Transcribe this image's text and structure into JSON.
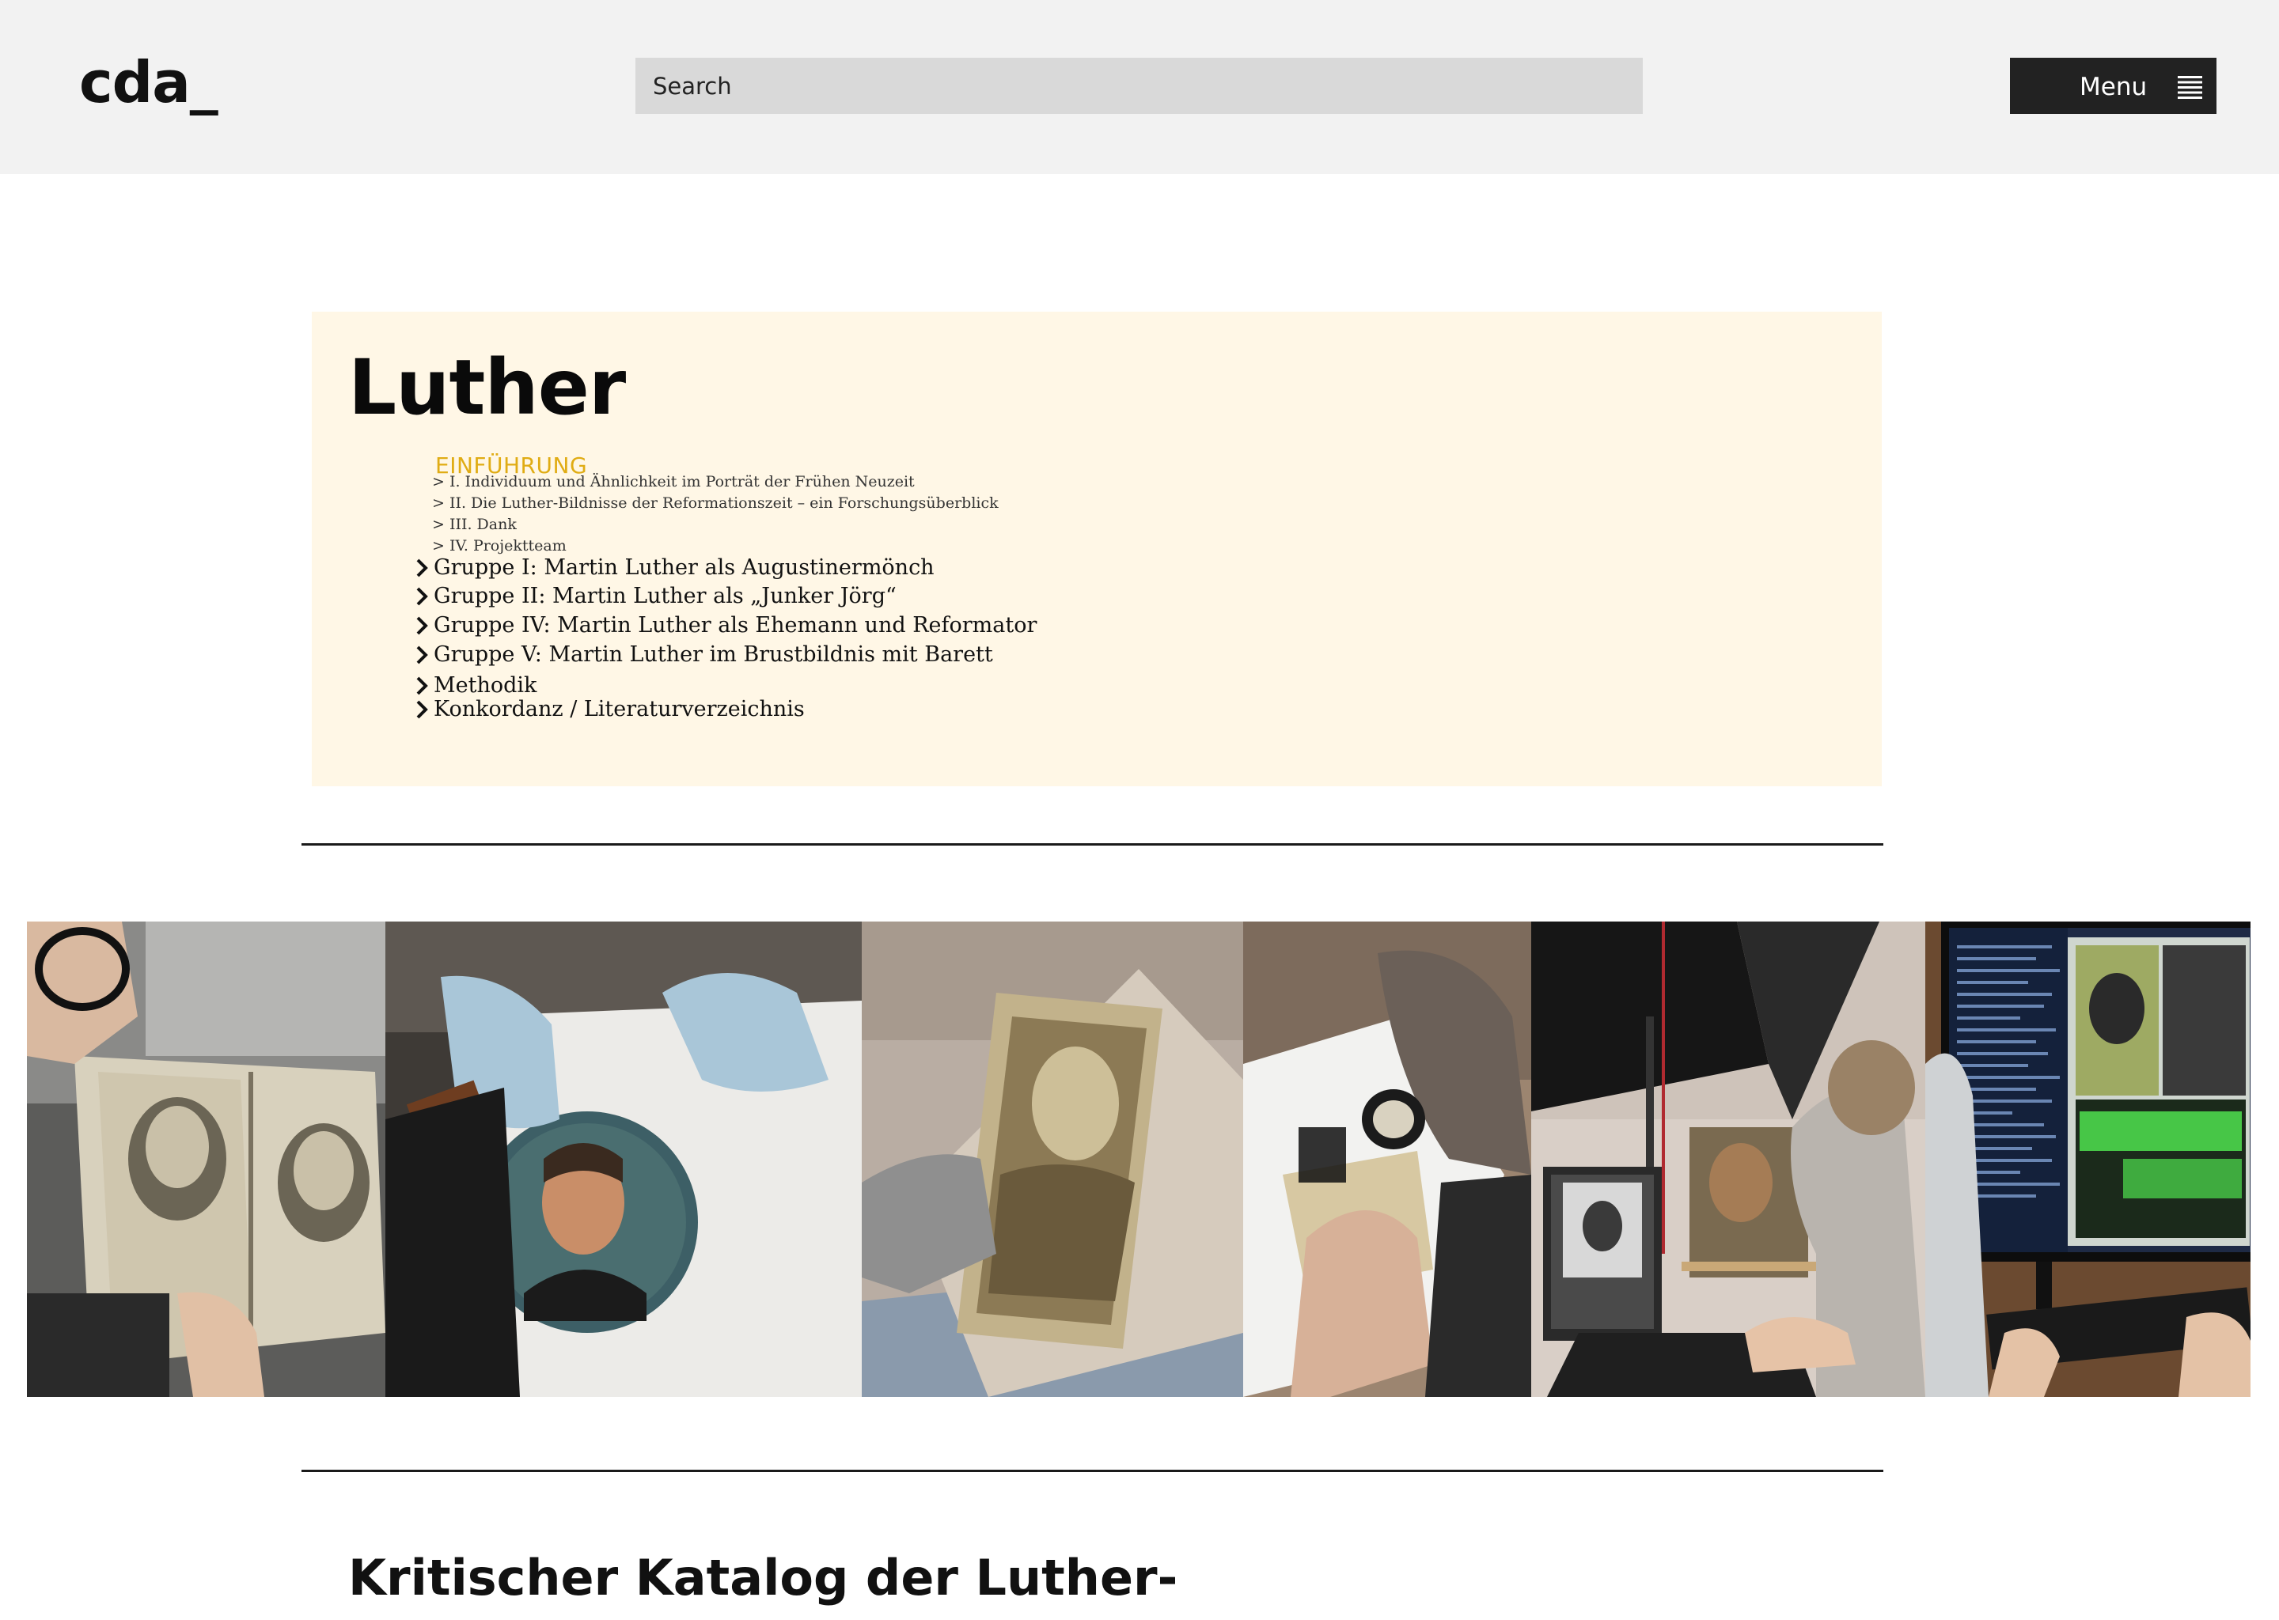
{
  "header": {
    "logo": "cda_",
    "search_placeholder": "Search",
    "menu_label": "Menu",
    "menu_icon": "hamburger-icon"
  },
  "intro": {
    "title": "Luther",
    "toc_heading": "EINFÜHRUNG",
    "subsections": [
      "> I. Individuum und Ähnlichkeit im Porträt der Frühen Neuzeit",
      "> II. Die Luther-Bildnisse der Reformationszeit – ein Forschungsüberblick",
      "> III. Dank",
      "> IV. Projektteam"
    ],
    "groups": [
      "Gruppe I: Martin Luther als Augustinermönch",
      "Gruppe II: Martin Luther als „Junker Jörg“",
      "Gruppe IV: Martin Luther als Ehemann und Reformator",
      "Gruppe V: Martin Luther im Brustbildnis mit Barett",
      "Methodik",
      "Konkordanz / Literaturverzeichnis"
    ],
    "chevron_icon": "chevron-right-icon"
  },
  "photos": [
    "photo-book-woodcut",
    "photo-gloved-hands-roundel",
    "photo-engraving-light-table",
    "photo-magnifier-examination",
    "photo-camera-setup",
    "photo-computer-analysis"
  ],
  "main": {
    "title": "Kritischer Katalog der Luther-"
  }
}
